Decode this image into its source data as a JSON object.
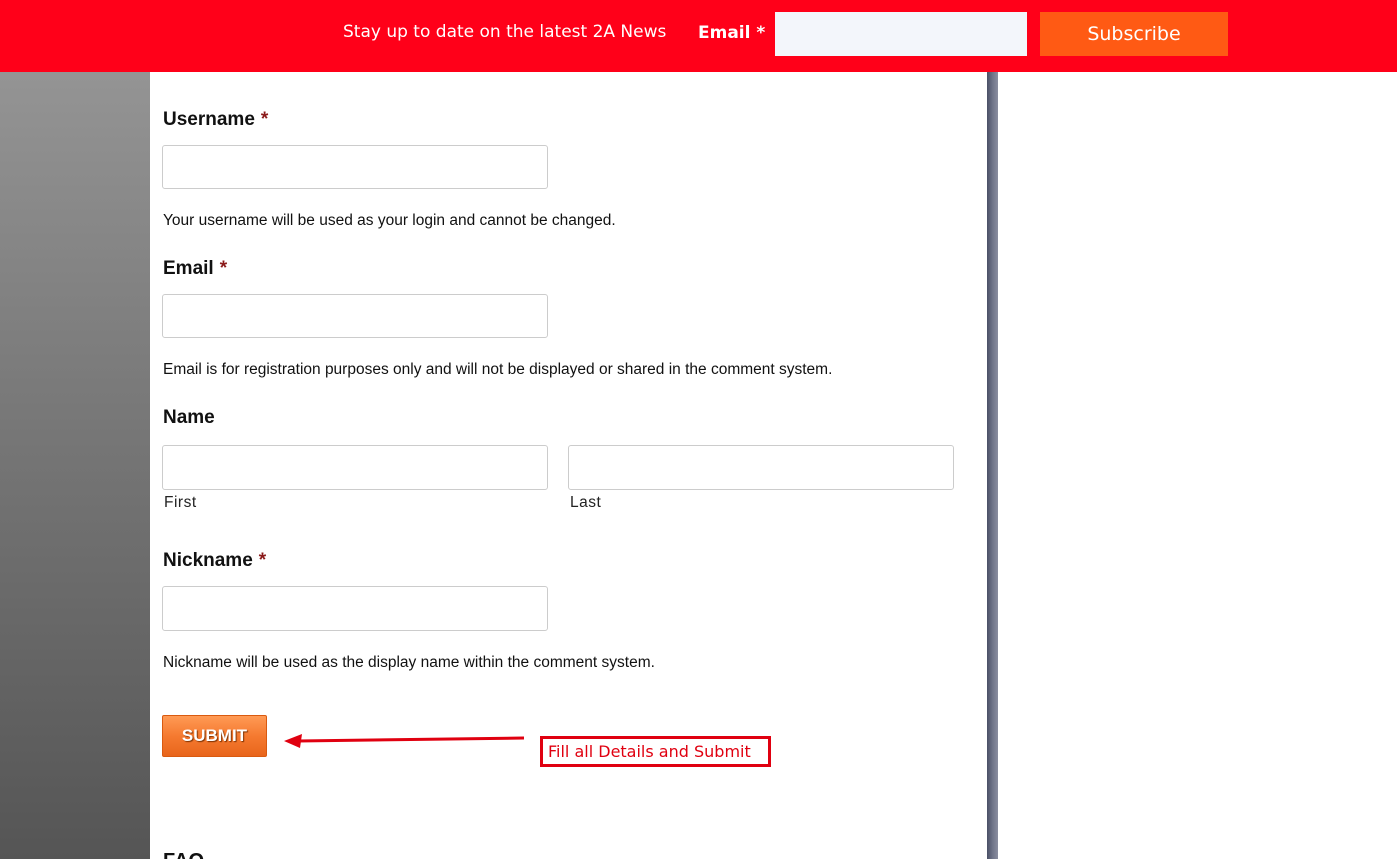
{
  "banner": {
    "tagline": "Stay up to date on the latest 2A News",
    "email_label": "Email *",
    "email_value": "",
    "subscribe_label": "Subscribe",
    "background_color": "#ff0019",
    "button_color": "#ff5a14"
  },
  "form": {
    "username": {
      "label": "Username",
      "required_mark": "*",
      "value": "",
      "help": "Your username will be used as your login and cannot be changed."
    },
    "email": {
      "label": "Email",
      "required_mark": "*",
      "value": "",
      "help": "Email is for registration purposes only and will not be displayed or shared in the comment system."
    },
    "name": {
      "label": "Name",
      "first_value": "",
      "first_sublabel": "First",
      "last_value": "",
      "last_sublabel": "Last"
    },
    "nickname": {
      "label": "Nickname",
      "required_mark": "*",
      "value": "",
      "help": "Nickname will be used as the display name within the comment system."
    },
    "submit_label": "SUBMIT"
  },
  "annotation": {
    "text": "Fill all Details and Submit",
    "color": "#e00010"
  },
  "faq": {
    "heading": "FAQ"
  }
}
